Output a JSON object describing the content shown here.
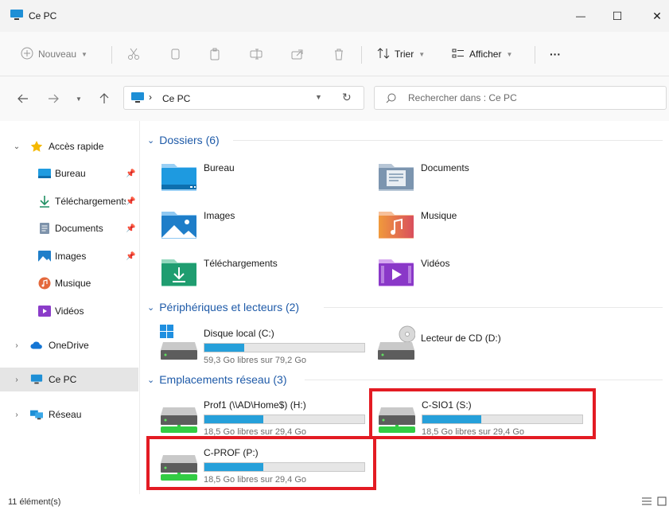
{
  "window": {
    "title": "Ce PC",
    "minimize": "—",
    "maximize": "☐",
    "close": "✕"
  },
  "toolbar": {
    "new_label": "Nouveau",
    "sort_label": "Trier",
    "view_label": "Afficher",
    "more_label": "···"
  },
  "address": {
    "location": "Ce PC"
  },
  "search": {
    "placeholder": "Rechercher dans : Ce PC"
  },
  "sidebar": {
    "quick_access": "Accès rapide",
    "items": [
      {
        "label": "Bureau"
      },
      {
        "label": "Téléchargements"
      },
      {
        "label": "Documents"
      },
      {
        "label": "Images"
      },
      {
        "label": "Musique"
      },
      {
        "label": "Vidéos"
      }
    ],
    "onedrive": "OneDrive",
    "this_pc": "Ce PC",
    "network": "Réseau"
  },
  "groups": {
    "folders": "Dossiers (6)",
    "devices": "Périphériques et lecteurs (2)",
    "network": "Emplacements réseau (3)"
  },
  "folders": [
    {
      "name": "Bureau"
    },
    {
      "name": "Documents"
    },
    {
      "name": "Images"
    },
    {
      "name": "Musique"
    },
    {
      "name": "Téléchargements"
    },
    {
      "name": "Vidéos"
    }
  ],
  "devices": [
    {
      "name": "Disque local (C:)",
      "free": "59,3 Go libres sur 79,2 Go",
      "used_fraction": 0.25
    },
    {
      "name": "Lecteur de CD (D:)"
    }
  ],
  "network_drives": [
    {
      "name": "Prof1 (\\\\AD\\Home$) (H:)",
      "free": "18,5 Go libres sur 29,4 Go",
      "used_fraction": 0.37
    },
    {
      "name": "C-SIO1 (S:)",
      "free": "18,5 Go libres sur 29,4 Go",
      "used_fraction": 0.37
    },
    {
      "name": "C-PROF (P:)",
      "free": "18,5 Go libres sur 29,4 Go",
      "used_fraction": 0.37
    }
  ],
  "status": {
    "count": "11 élément(s)"
  },
  "colors": {
    "accent": "#26a0da",
    "group_header": "#1e5aa8",
    "highlight": "#e31b23"
  }
}
